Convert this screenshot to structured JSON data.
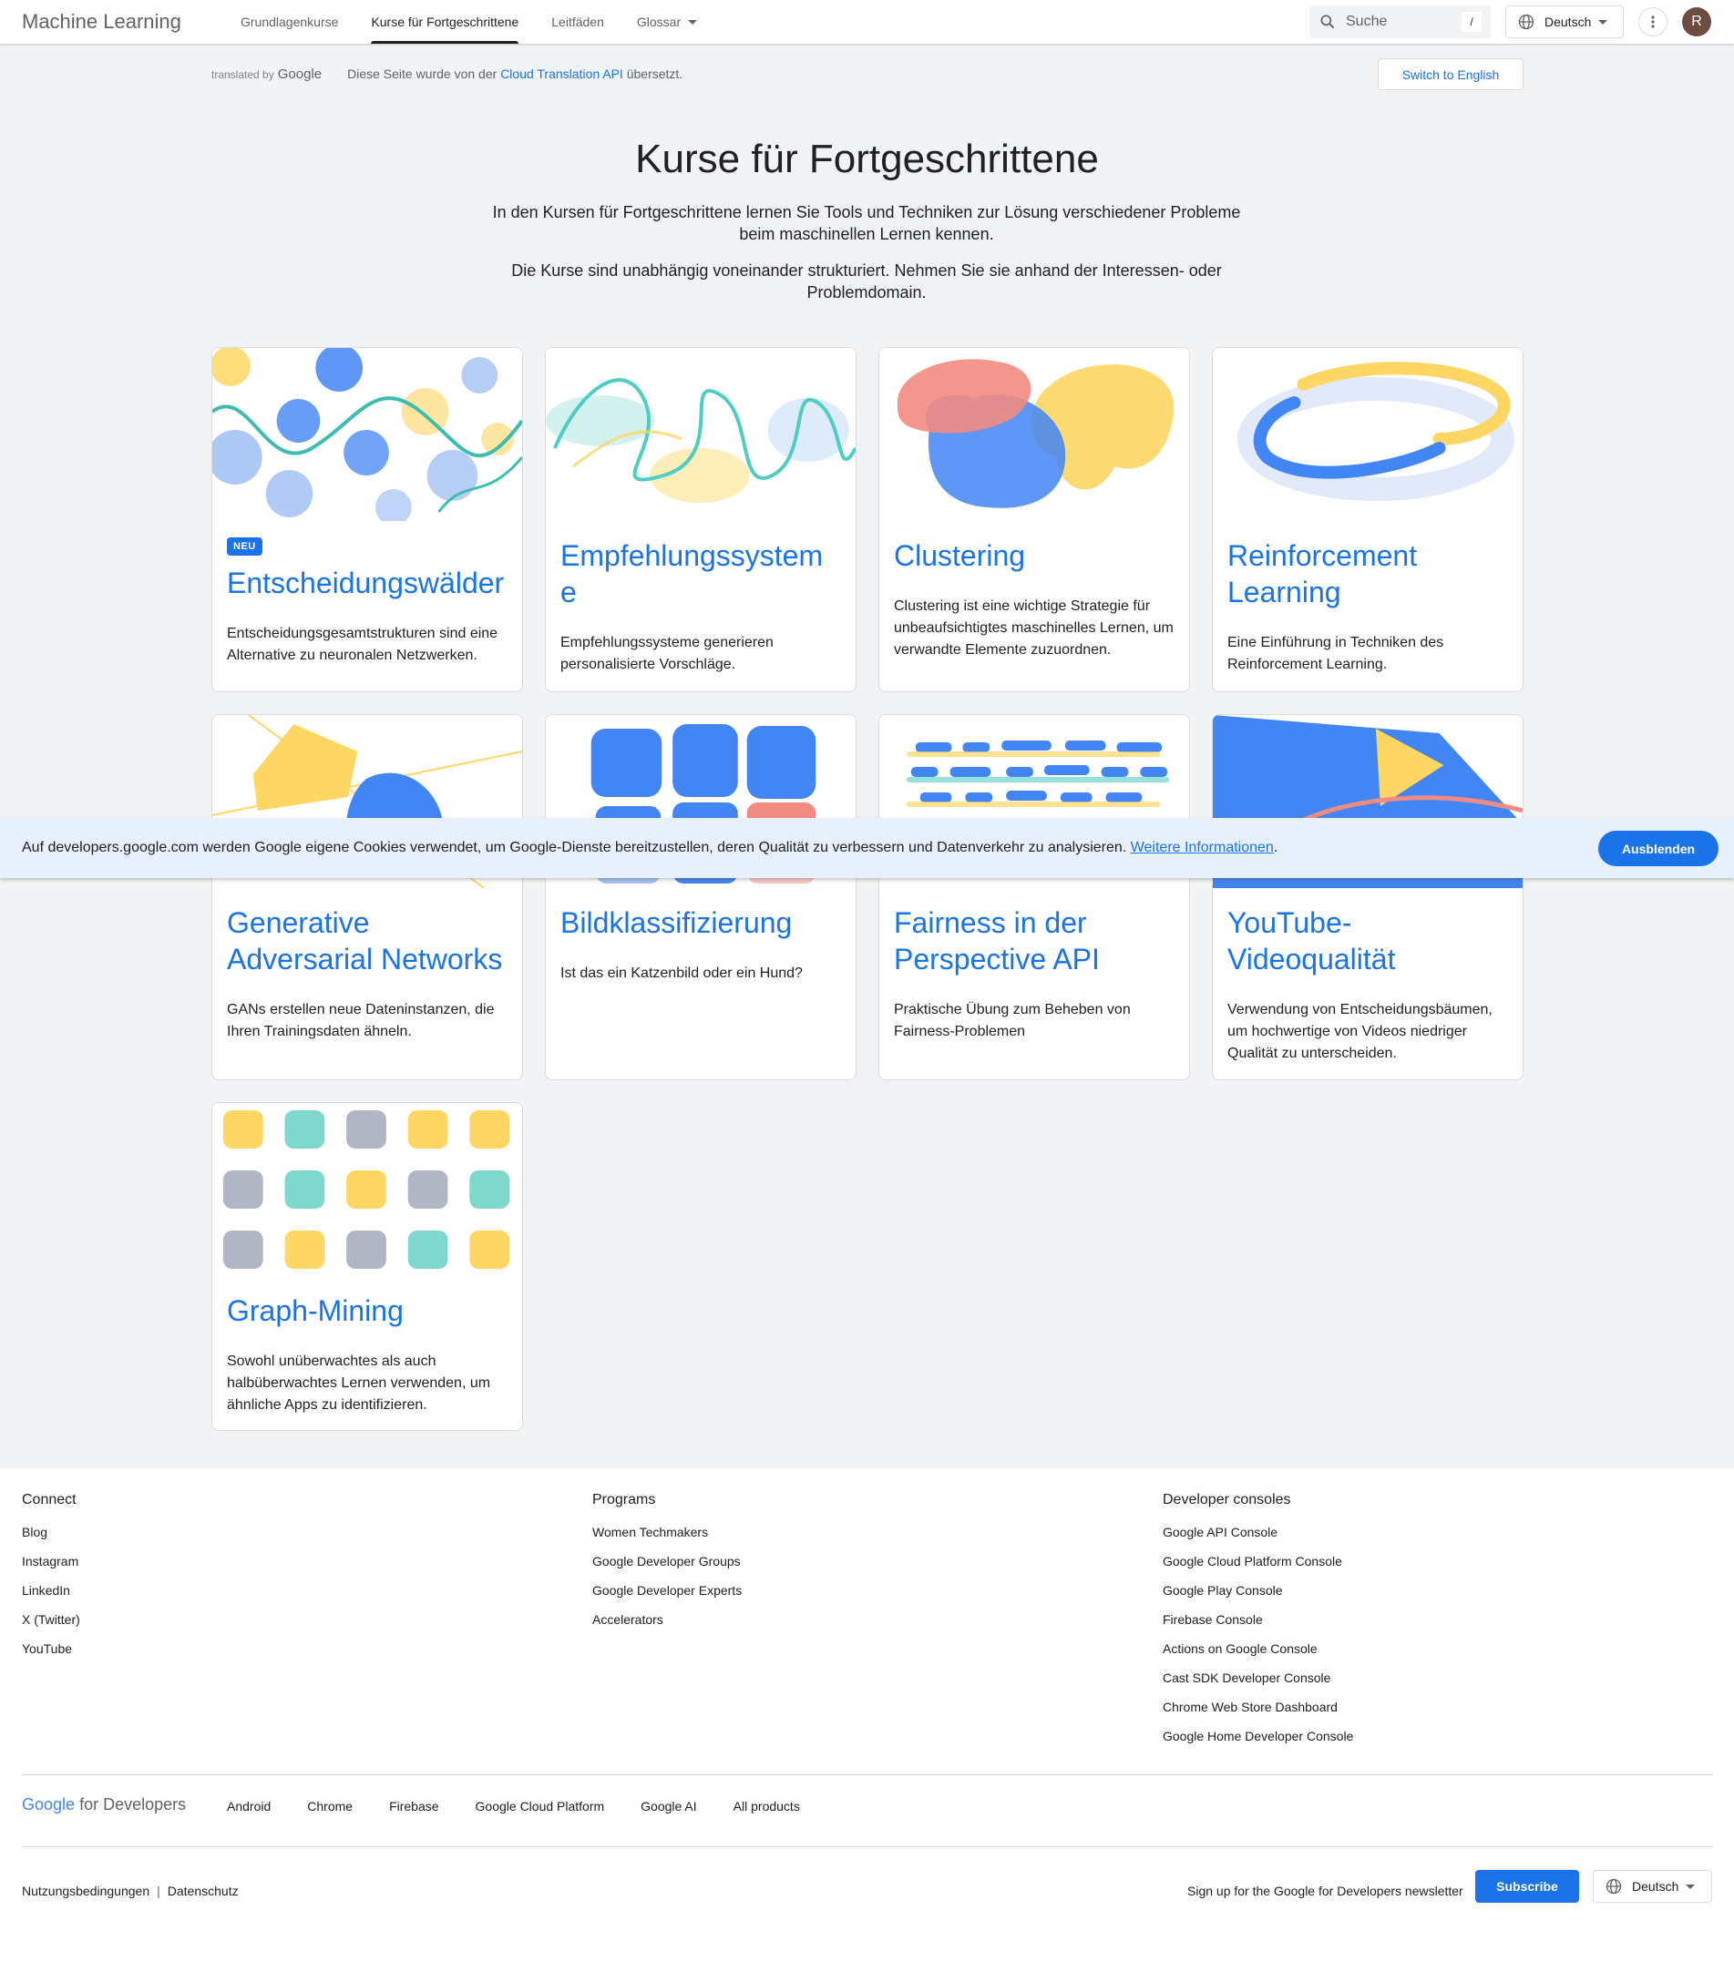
{
  "header": {
    "brand": "Machine Learning",
    "nav": [
      {
        "label": "Grundlagenkurse"
      },
      {
        "label": "Kurse für Fortgeschrittene"
      },
      {
        "label": "Leitfäden"
      },
      {
        "label": "Glossar"
      }
    ],
    "search_placeholder": "Suche",
    "search_shortcut": "/",
    "language": "Deutsch",
    "avatar_initial": "R"
  },
  "translation_bar": {
    "translated_by": "translated by",
    "google_word": "Google",
    "notice_before": "Diese Seite wurde von der ",
    "notice_link": "Cloud Translation API",
    "notice_after": " übersetzt.",
    "switch_button": "Switch to English"
  },
  "hero": {
    "title": "Kurse für Fortgeschrittene",
    "paragraph1": "In den Kursen für Fortgeschrittene lernen Sie Tools und Techniken zur Lösung verschiedener Probleme beim maschinellen Lernen kennen.",
    "paragraph2": "Die Kurse sind unabhängig voneinander strukturiert. Nehmen Sie sie anhand der Interessen- oder Problemdomain."
  },
  "cards": [
    {
      "badge": "NEU",
      "title": "Entscheidungswälder",
      "description": "Entscheidungsgesamtstrukturen sind eine Alternative zu neuronalen Netzwerken.",
      "image": "decision-forests-illustration"
    },
    {
      "title": "Empfehlungssystem e",
      "description": "Empfehlungssysteme generieren personalisierte Vorschläge.",
      "image": "recommendation-illustration"
    },
    {
      "title": "Clustering",
      "description": "Clustering ist eine wichtige Strategie für unbeaufsichtigtes maschinelles Lernen, um verwandte Elemente zuzuordnen.",
      "image": "clustering-illustration"
    },
    {
      "title": "Reinforcement Learning",
      "description": "Eine Einführung in Techniken des Reinforcement Learning.",
      "image": "reinforcement-illustration"
    },
    {
      "title": "Generative Adversarial Networks",
      "description": "GANs erstellen neue Dateninstanzen, die Ihren Trainingsdaten ähneln.",
      "image": "gan-illustration"
    },
    {
      "title": "Bildklassifizierung",
      "description": "Ist das ein Katzenbild oder ein Hund?",
      "image": "image-classification-illustration"
    },
    {
      "title": "Fairness in der Perspective API",
      "description": "Praktische Übung zum Beheben von Fairness-Problemen",
      "image": "fairness-illustration"
    },
    {
      "title": "YouTube-Videoqualität",
      "description": "Verwendung von Entscheidungsbäumen, um hochwertige von Videos niedriger Qualität zu unterscheiden.",
      "image": "youtube-quality-illustration"
    },
    {
      "title": "Graph-Mining",
      "description": "Sowohl unüberwachtes als auch halbüberwachtes Lernen verwenden, um ähnliche Apps zu identifizieren.",
      "image": "graph-mining-illustration"
    }
  ],
  "cookie_banner": {
    "text": "Auf developers.google.com werden Google eigene Cookies verwendet, um Google-Dienste bereitzustellen, deren Qualität zu verbessern und Datenverkehr zu analysieren. ",
    "link": "Weitere Informationen",
    "after": ".",
    "button": "Ausblenden"
  },
  "footer": {
    "connect": {
      "heading": "Connect",
      "links": [
        "Blog",
        "Instagram",
        "LinkedIn",
        "X (Twitter)",
        "YouTube"
      ]
    },
    "programs": {
      "heading": "Programs",
      "links": [
        "Women Techmakers",
        "Google Developer Groups",
        "Google Developer Experts",
        "Accelerators"
      ]
    },
    "consoles": {
      "heading": "Developer consoles",
      "links": [
        "Google API Console",
        "Google Cloud Platform Console",
        "Google Play Console",
        "Firebase Console",
        "Actions on Google Console",
        "Cast SDK Developer Console",
        "Chrome Web Store Dashboard",
        "Google Home Developer Console"
      ]
    },
    "logo_google": "Google",
    "logo_suffix": "for Developers",
    "products": [
      "Android",
      "Chrome",
      "Firebase",
      "Google Cloud Platform",
      "Google AI",
      "All products"
    ],
    "legal": [
      "Nutzungsbedingungen",
      "Datenschutz"
    ],
    "legal_separator": "|",
    "newsletter": "Sign up for the Google for Developers newsletter",
    "subscribe": "Subscribe",
    "language": "Deutsch"
  },
  "colors": {
    "accent": "#1a73e8",
    "yellow": "#fdd663",
    "blue": "#4285f4",
    "teal": "#4ecdc4",
    "red": "#f28b82",
    "gray": "#b0b6c3"
  }
}
